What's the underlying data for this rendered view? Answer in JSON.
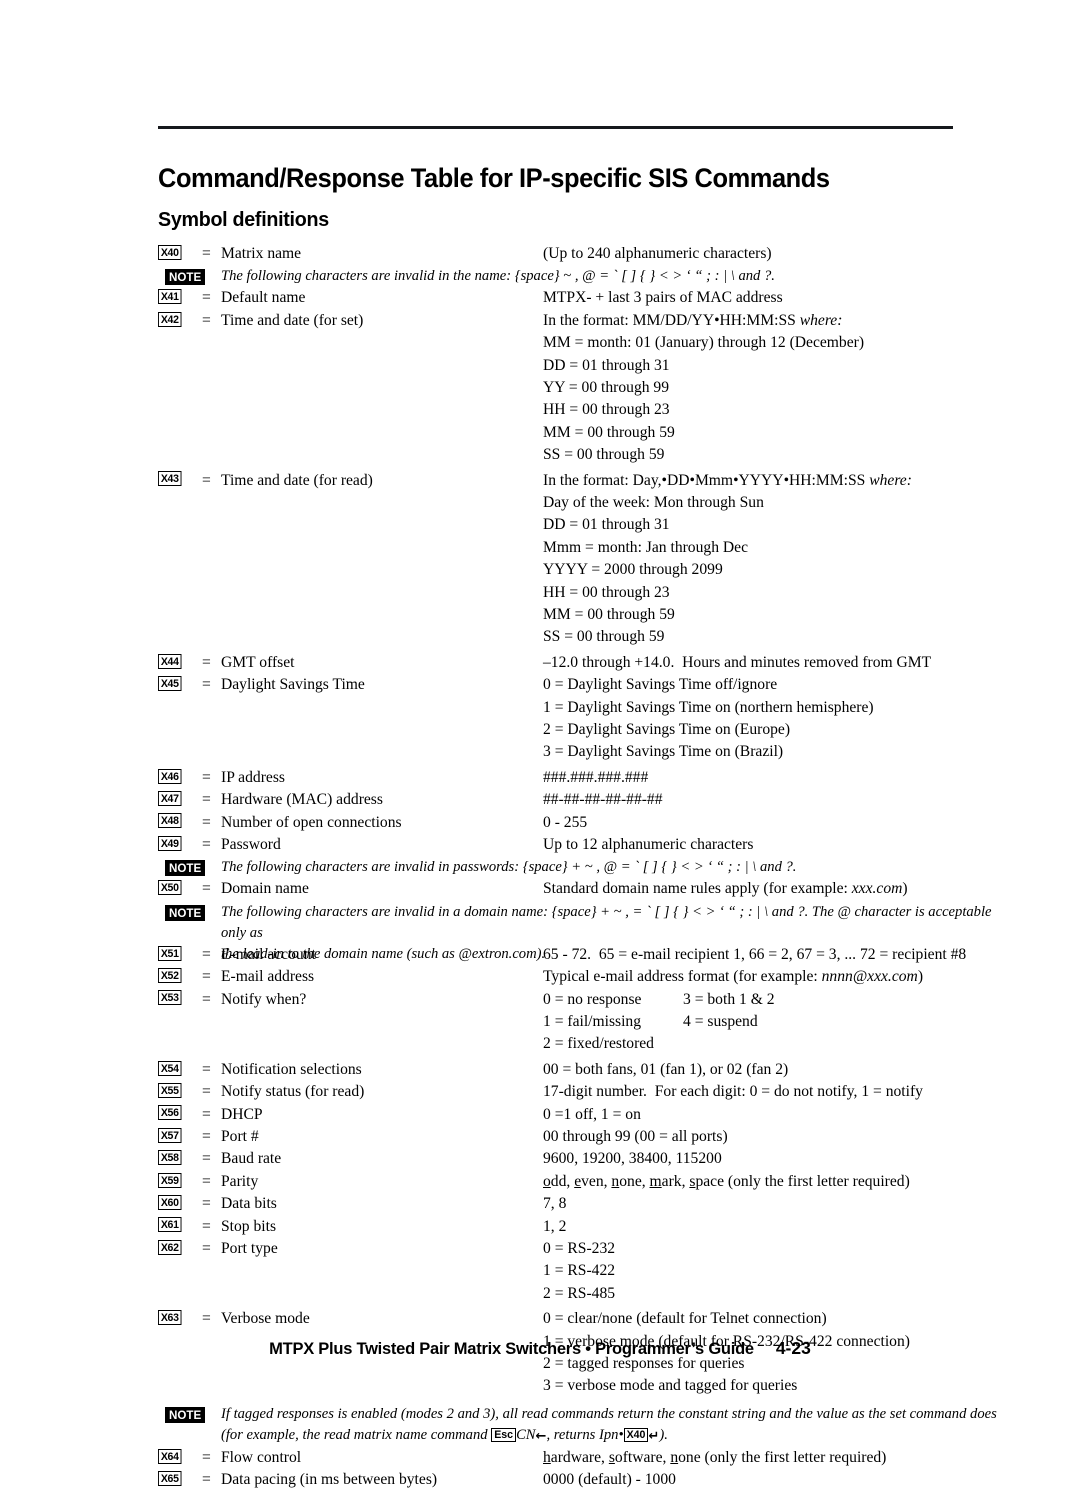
{
  "page": {
    "title": "Command/Response Table for IP-specific SIS Commands",
    "subtitle": "Symbol definitions",
    "equals": "="
  },
  "footer": {
    "text": "MTPX Plus Twisted Pair Matrix Switchers • Programmer’s Guide",
    "page_number": "4-23"
  },
  "note_label": "NOTE",
  "rows": [
    {
      "kind": "symbol",
      "tag": "X40",
      "desc": "Matrix name",
      "value": "(Up to 240 alphanumeric characters)"
    },
    {
      "kind": "note",
      "text": "The following characters are invalid in the name: {space} ~ , @ = ` [ ] { } < > ‘ “ ; : | \\ and ?."
    },
    {
      "kind": "symbol",
      "tag": "X41",
      "desc": "Default name",
      "value": "MTPX- + last 3 pairs of MAC address"
    },
    {
      "kind": "symbol",
      "tag": "X42",
      "desc": "Time and date (for set)",
      "value_lines": [
        "In the format: MM/DD/YY•HH:MM:SS where:",
        "MM = month: 01 (January) through 12 (December)",
        "DD = 01 through 31",
        "YY = 00 through 99",
        "HH = 00 through 23",
        "MM = 00 through 59",
        "SS = 00 through 59"
      ],
      "italic_tail_first_line": "where:"
    },
    {
      "kind": "symbol",
      "tag": "X43",
      "desc": "Time and date (for read)",
      "value_lines": [
        "In the format: Day,•DD•Mmm•YYYY•HH:MM:SS where:",
        "Day of the week: Mon through Sun",
        "DD = 01 through 31",
        "Mmm = month: Jan through Dec",
        "YYYY = 2000 through 2099",
        "HH = 00 through 23",
        "MM = 00 through 59",
        "SS = 00 through 59"
      ],
      "italic_tail_first_line": "where:"
    },
    {
      "kind": "symbol",
      "tag": "X44",
      "desc": "GMT offset",
      "value": "–12.0 through +14.0.  Hours and minutes removed from GMT"
    },
    {
      "kind": "symbol",
      "tag": "X45",
      "desc": "Daylight Savings Time",
      "value_lines": [
        "0 = Daylight Savings Time off/ignore",
        "1 = Daylight Savings Time on (northern hemisphere)",
        "2 = Daylight Savings Time on (Europe)",
        "3 = Daylight Savings Time on (Brazil)"
      ]
    },
    {
      "kind": "symbol",
      "tag": "X46",
      "desc": "IP address",
      "value": "###.###.###.###"
    },
    {
      "kind": "symbol",
      "tag": "X47",
      "desc": "Hardware (MAC) address",
      "value": "##-##-##-##-##-##"
    },
    {
      "kind": "symbol",
      "tag": "X48",
      "desc": "Number of open connections",
      "value": "0 - 255"
    },
    {
      "kind": "symbol",
      "tag": "X49",
      "desc": "Password",
      "value": "Up to 12 alphanumeric characters"
    },
    {
      "kind": "note",
      "text": "The following characters are invalid in passwords: {space} + ~ , @ = ` [ ] { } < > ‘ “ ; : | \\ and ?."
    },
    {
      "kind": "symbol",
      "tag": "X50",
      "desc": "Domain name",
      "value": "Standard domain name rules apply (for example: xxx.com)",
      "italic_tail": "xxx.com"
    },
    {
      "kind": "note",
      "text": "The following characters are invalid in a domain name: {space} + ~ , = ` [ ] { } < > ‘ “ ; : | \\ and ?.  The @ character is acceptable only as",
      "text2": "the lead-in to the domain name (such as @extron.com)."
    },
    {
      "kind": "symbol",
      "tag": "X51",
      "desc": "E-mail account",
      "value": "65 - 72.  65 = e-mail recipient 1, 66 = 2, 67 = 3, ... 72 = recipient #8"
    },
    {
      "kind": "symbol",
      "tag": "X52",
      "desc": "E-mail address",
      "value": "Typical e-mail address format (for example: nnnn@xxx.com)",
      "italic_tail": "nnnn@xxx.com"
    },
    {
      "kind": "symbol",
      "tag": "X53",
      "desc": "Notify when?",
      "value_grid": [
        [
          "0 = no response",
          "3 = both 1 & 2"
        ],
        [
          "1 = fail/missing",
          "4 = suspend"
        ],
        [
          "2 = fixed/restored",
          ""
        ]
      ]
    },
    {
      "kind": "symbol",
      "tag": "X54",
      "desc": "Notification selections",
      "value": "00 = both fans, 01 (fan 1), or 02 (fan 2)"
    },
    {
      "kind": "symbol",
      "tag": "X55",
      "desc": "Notify status (for read)",
      "value": "17-digit number.  For each digit: 0 = do not notify, 1 = notify"
    },
    {
      "kind": "symbol",
      "tag": "X56",
      "desc": "DHCP",
      "value": "0 =1 off, 1 = on"
    },
    {
      "kind": "symbol",
      "tag": "X57",
      "desc": "Port #",
      "value": "00 through 99 (00 = all ports)"
    },
    {
      "kind": "symbol",
      "tag": "X58",
      "desc": "Baud rate",
      "value": "9600, 19200, 38400, 115200"
    },
    {
      "kind": "symbol",
      "tag": "X59",
      "desc": "Parity",
      "value": "odd, even, none, mark, space (only the first letter required)",
      "underline_first_letters": true
    },
    {
      "kind": "symbol",
      "tag": "X60",
      "desc": "Data bits",
      "value": "7, 8"
    },
    {
      "kind": "symbol",
      "tag": "X61",
      "desc": "Stop bits",
      "value": "1, 2"
    },
    {
      "kind": "symbol",
      "tag": "X62",
      "desc": "Port type",
      "value_lines": [
        "0 = RS-232",
        "1 = RS-422",
        "2 = RS-485"
      ]
    },
    {
      "kind": "symbol",
      "tag": "X63",
      "desc": "Verbose mode",
      "value_lines": [
        "0 = clear/none (default for Telnet connection)",
        "1 = verbose mode (default for RS-232/RS-422 connection)",
        "2 = tagged responses for queries",
        "3 = verbose mode and tagged for queries"
      ]
    },
    {
      "kind": "note_rich",
      "text_a": "If tagged responses is enabled (modes 2 and 3), all read commands return the constant string and the value as the set command does",
      "text_b_pre": "(for example, the read matrix name command ",
      "key_esc": "Esc",
      "text_b_mid": "CN",
      "arrow_left": "←",
      "text_b_mid2": ", returns Ipn•",
      "key_x40": "X40",
      "arrow_return": "↵",
      "text_b_post": ")."
    },
    {
      "kind": "symbol",
      "tag": "X64",
      "desc": "Flow control",
      "value": "hardware, software, none (only the first letter required)",
      "underline_first_letters": true
    },
    {
      "kind": "symbol",
      "tag": "X65",
      "desc": "Data pacing (in ms between bytes)",
      "value": "0000 (default) - 1000"
    }
  ]
}
